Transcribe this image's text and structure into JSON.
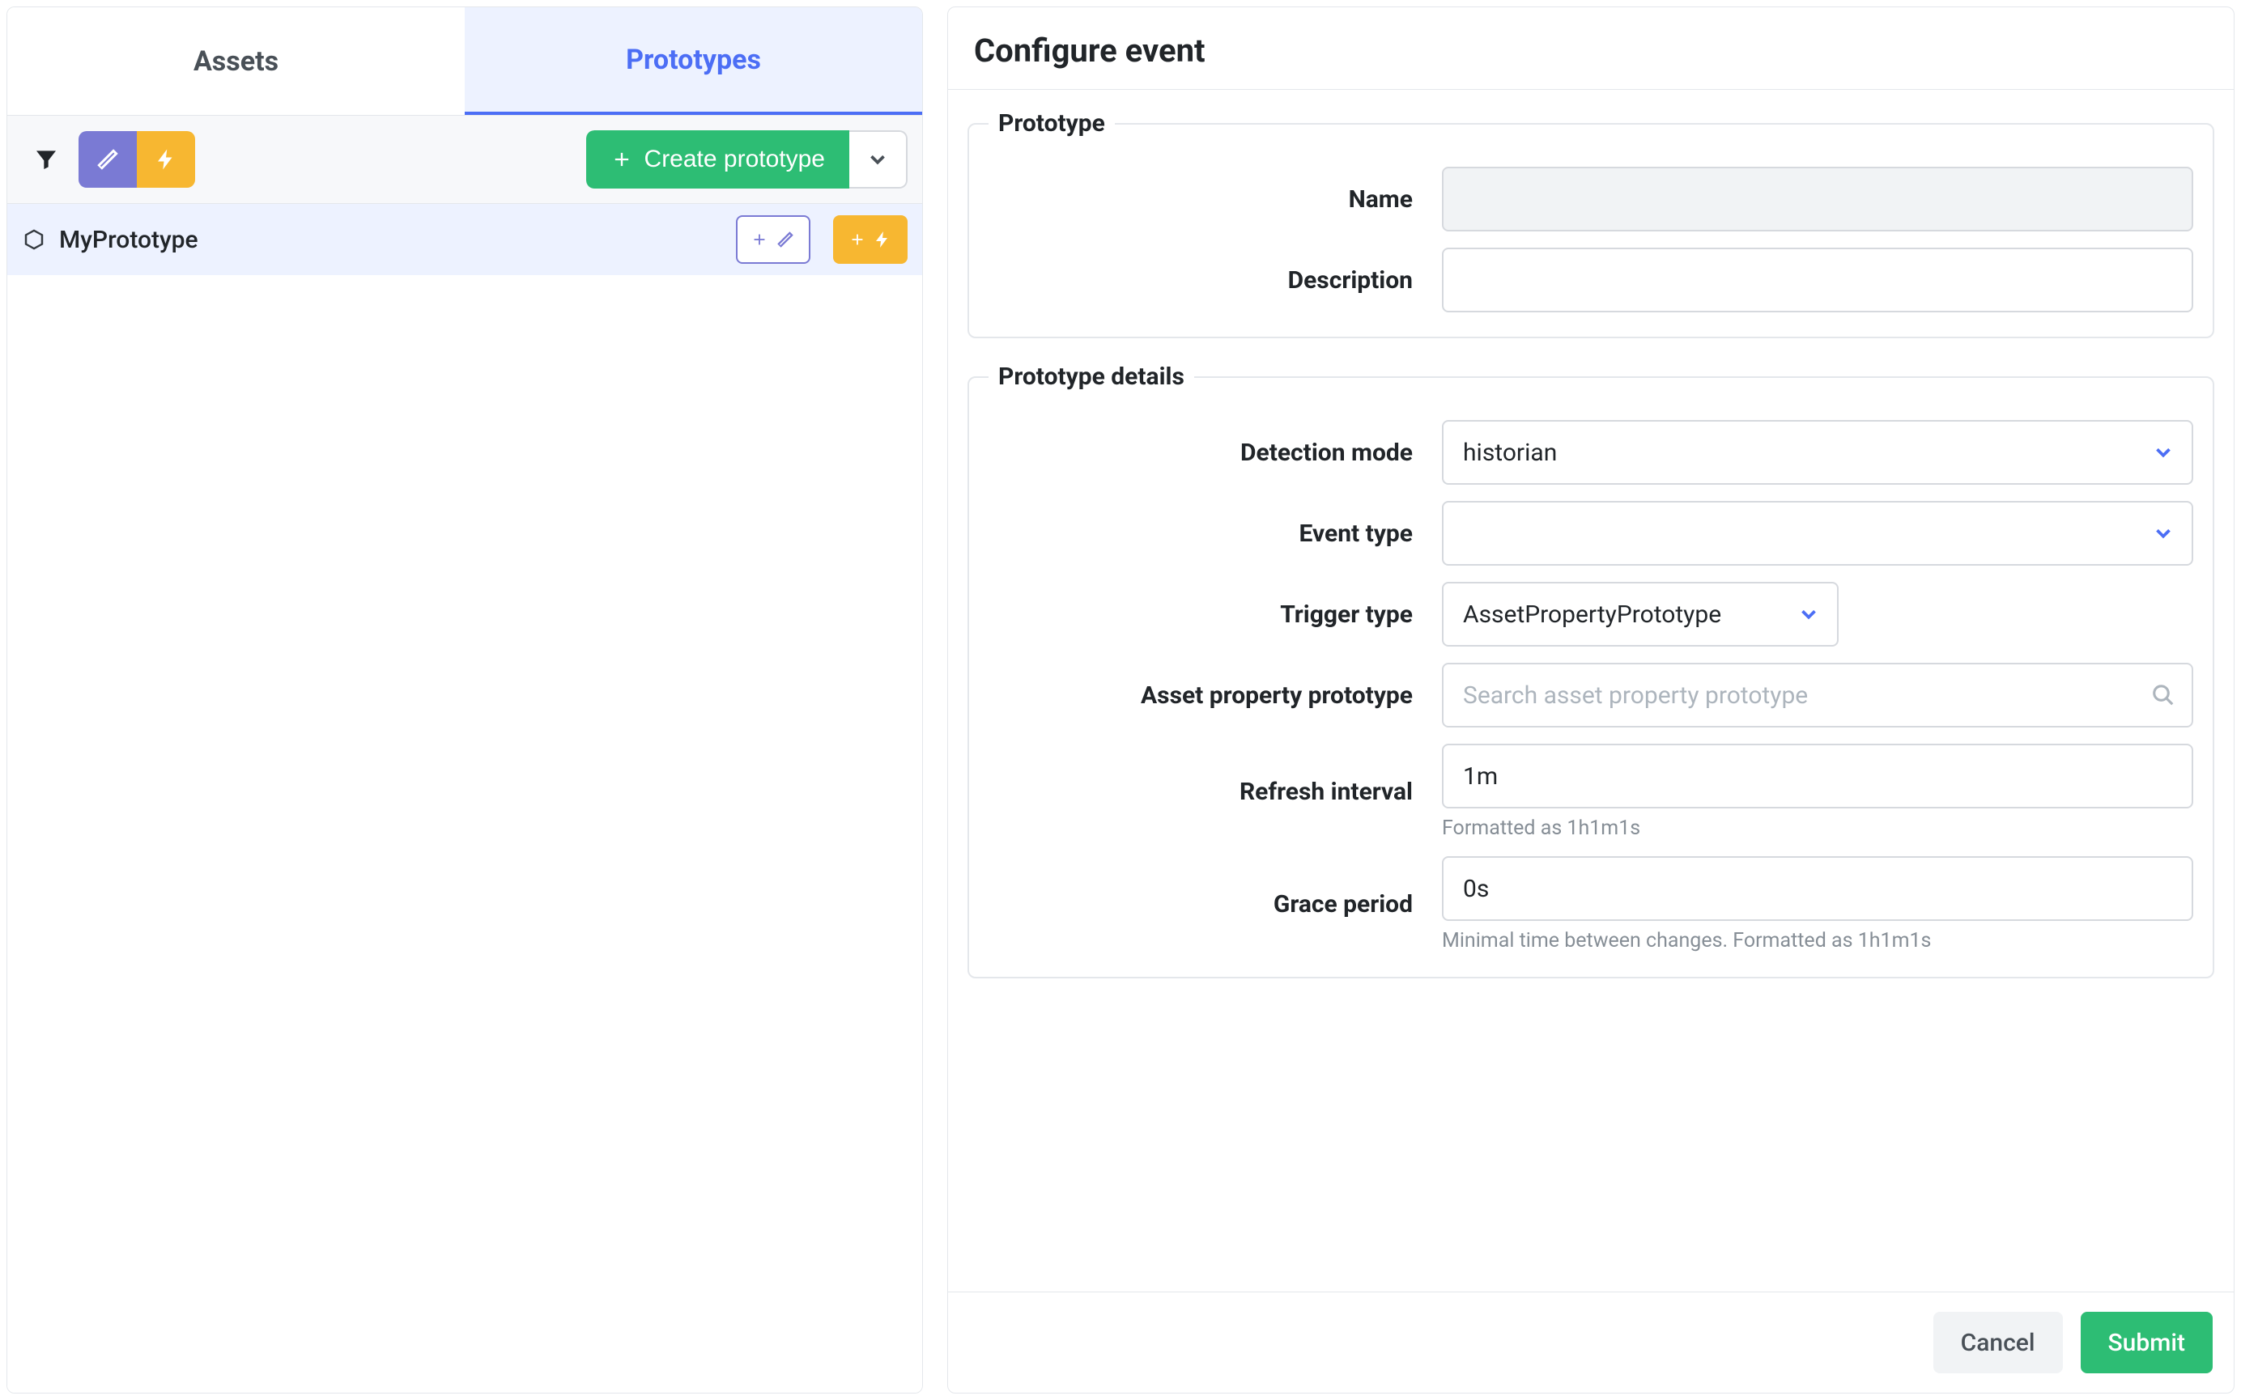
{
  "left": {
    "tabs": {
      "assets": "Assets",
      "prototypes": "Prototypes"
    },
    "create_label": "Create prototype",
    "rows": [
      {
        "label": "MyPrototype"
      }
    ]
  },
  "right": {
    "title": "Configure event",
    "sections": {
      "prototype": {
        "legend": "Prototype",
        "name_label": "Name",
        "name_value": "",
        "description_label": "Description",
        "description_value": ""
      },
      "details": {
        "legend": "Prototype details",
        "detection_mode_label": "Detection mode",
        "detection_mode_value": "historian",
        "event_type_label": "Event type",
        "event_type_value": "",
        "trigger_type_label": "Trigger type",
        "trigger_type_value": "AssetPropertyPrototype",
        "asset_prop_label": "Asset property prototype",
        "asset_prop_placeholder": "Search asset property prototype",
        "refresh_label": "Refresh interval",
        "refresh_value": "1m",
        "refresh_help": "Formatted as 1h1m1s",
        "grace_label": "Grace period",
        "grace_value": "0s",
        "grace_help": "Minimal time between changes. Formatted as 1h1m1s"
      }
    },
    "footer": {
      "cancel": "Cancel",
      "submit": "Submit"
    }
  }
}
